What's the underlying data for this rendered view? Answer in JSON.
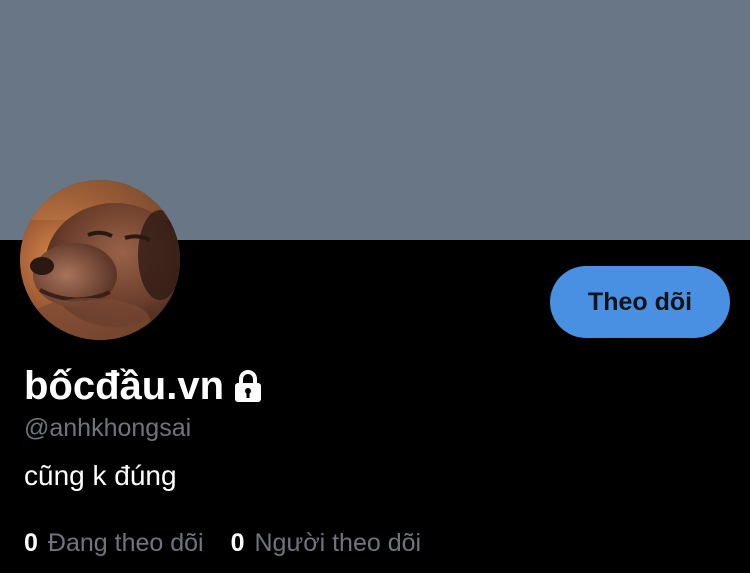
{
  "colors": {
    "banner": "#687685",
    "background": "#000000",
    "accent": "#4a90e2",
    "secondary_text": "#6e767d",
    "primary_text": "#ffffff"
  },
  "profile": {
    "display_name": "bốcđầu.vn",
    "protected_icon": "lock-icon",
    "handle": "@anhkhongsai",
    "bio": "cũng k đúng",
    "avatar": "dog-photo-avatar"
  },
  "follow_button": {
    "label": "Theo dõi"
  },
  "stats": [
    {
      "count": "0",
      "label": "Đang theo dõi"
    },
    {
      "count": "0",
      "label": "Người theo dõi"
    }
  ]
}
